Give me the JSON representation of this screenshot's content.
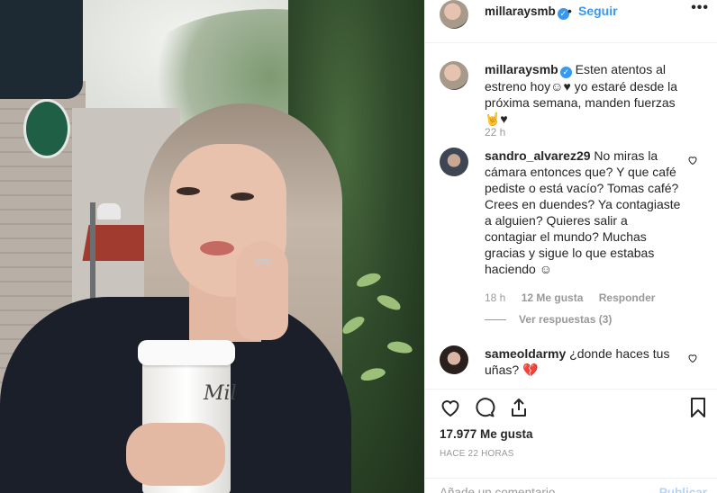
{
  "post": {
    "username": "millaraysmb",
    "dot": "•",
    "follow_label": "Seguir",
    "more_label": "•••"
  },
  "caption": {
    "username": "millaraysmb",
    "text": "Esten atentos al estreno hoy☺♥ yo estaré desde la próxima semana, manden fuerzas🤘♥",
    "time": "22 h"
  },
  "comments": [
    {
      "username": "sandro_alvarez29",
      "text": "No miras la cámara entonces que? Y que café pediste o está vacío? Tomas café? Crees en duendes? Ya contagiaste a alguien? Quieres salir a contagiar el mundo? Muchas gracias y sigue lo que estabas haciendo ☺",
      "time": "18 h",
      "likes": "12 Me gusta",
      "reply_label": "Responder",
      "view_replies": "Ver respuestas (3)"
    },
    {
      "username": "sameoldarmy",
      "text": "¿donde haces tus uñas? 💔"
    }
  ],
  "actions": {
    "likes": "17.977 Me gusta",
    "timestamp": "HACE 22 HORAS",
    "comment_placeholder": "Añade un comentario...",
    "publish_label": "Publicar"
  },
  "photo": {
    "cup_text": "Mil"
  },
  "colors": {
    "accent": "#3897f0",
    "muted": "#999999",
    "text": "#262626"
  }
}
